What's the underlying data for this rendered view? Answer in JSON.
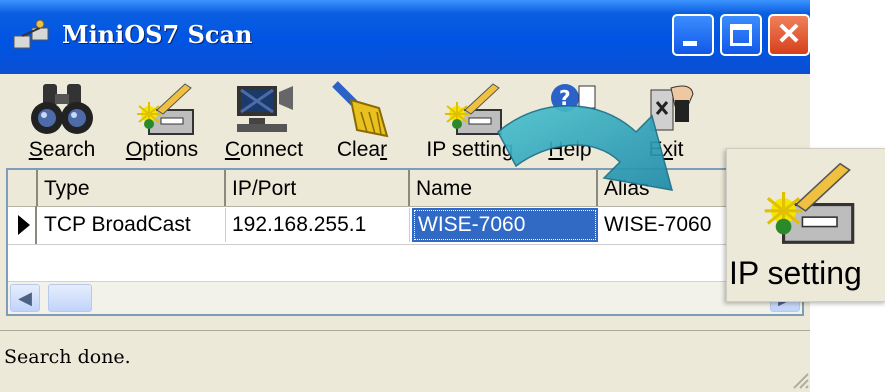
{
  "window": {
    "title": "MiniOS7 Scan",
    "icon": "network-scan-icon"
  },
  "toolbar": {
    "buttons": [
      {
        "label": "Search",
        "icon": "binoculars-icon",
        "mnemonic": "S"
      },
      {
        "label": "Options",
        "icon": "settings-pencil-icon",
        "mnemonic": "O"
      },
      {
        "label": "Connect",
        "icon": "computer-connect-icon",
        "mnemonic": "C"
      },
      {
        "label": "Clear",
        "icon": "broom-icon",
        "mnemonic": "r"
      },
      {
        "label": "IP setting",
        "icon": "ip-setting-icon"
      },
      {
        "label": "Help",
        "icon": "help-icon",
        "mnemonic": "H"
      },
      {
        "label": "Exit",
        "icon": "exit-icon"
      }
    ]
  },
  "table": {
    "columns": [
      "Type",
      "IP/Port",
      "Name",
      "Alias"
    ],
    "rows": [
      {
        "type": "TCP BroadCast",
        "ip": "192.168.255.1",
        "name": "WISE-7060",
        "alias": "WISE-7060"
      }
    ],
    "selected_cell": "name"
  },
  "status": {
    "text": "Search done."
  },
  "callout": {
    "label": "IP setting",
    "icon": "ip-setting-icon"
  },
  "colors": {
    "titlebar": "#0054e3",
    "selection": "#316ac5",
    "arrow": "#2aa4b8",
    "face": "#ece9d8"
  }
}
